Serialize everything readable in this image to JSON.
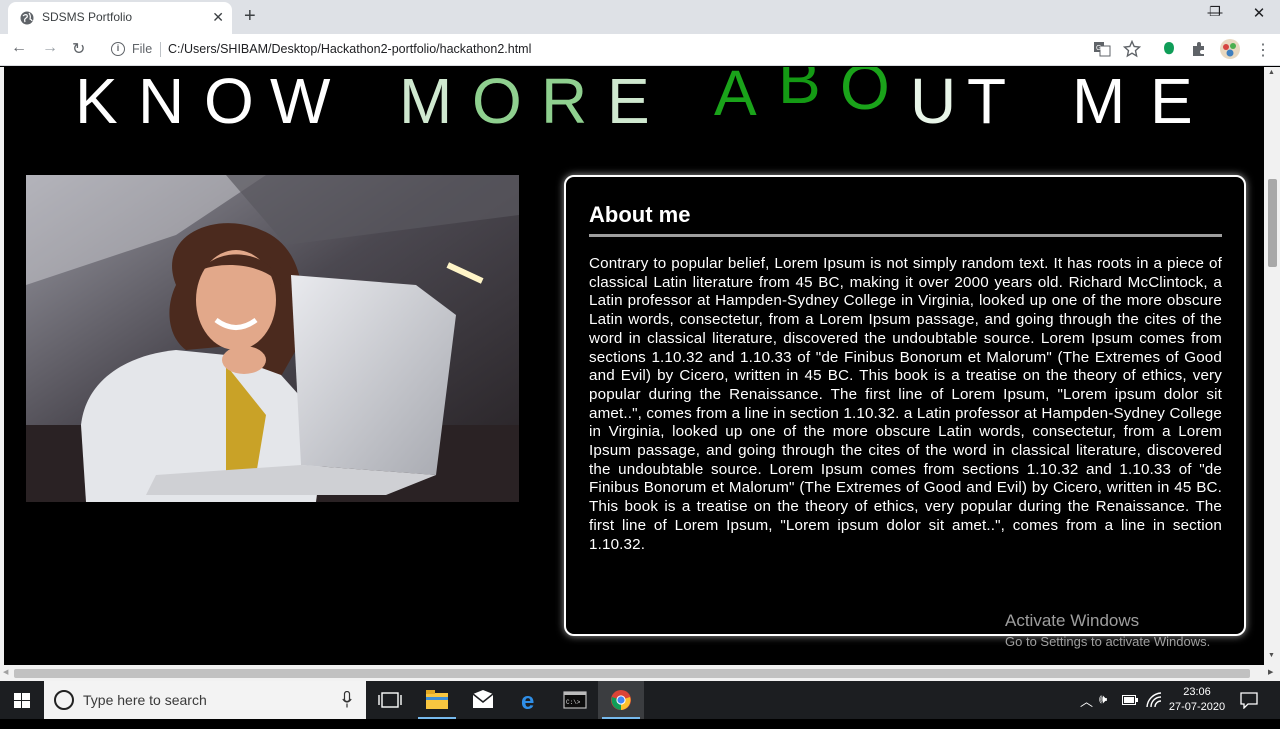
{
  "browser": {
    "tab_title": "SDSMS Portfolio",
    "tab_close": "✕",
    "new_tab": "+",
    "file_label": "File",
    "url": "C:/Users/SHIBAM/Desktop/Hackathon2-portfolio/hackathon2.html",
    "window_controls": [
      "—",
      "❐",
      "✕"
    ]
  },
  "page": {
    "heading_letters": [
      {
        "ch": "K",
        "color": "#ffffff"
      },
      {
        "ch": "N",
        "color": "#ffffff"
      },
      {
        "ch": "O",
        "color": "#ffffff"
      },
      {
        "ch": "W",
        "color": "#ffffff"
      },
      {
        "ch": "M",
        "color": "#cfe8cf"
      },
      {
        "ch": "O",
        "color": "#8fd08f"
      },
      {
        "ch": "R",
        "color": "#8fd08f"
      },
      {
        "ch": "E",
        "color": "#cfe8cf"
      },
      {
        "ch": "A",
        "color": "#1aa31a"
      },
      {
        "ch": "B",
        "color": "#149a14"
      },
      {
        "ch": "O",
        "color": "#1aa31a"
      },
      {
        "ch": "U",
        "color": "#e8f5e8"
      },
      {
        "ch": "T",
        "color": "#ffffff"
      },
      {
        "ch": "M",
        "color": "#ffffff"
      },
      {
        "ch": "E",
        "color": "#ffffff"
      }
    ],
    "about_title": "About me",
    "about_text": "Contrary to popular belief, Lorem Ipsum is not simply random text. It has roots in a piece of classical Latin literature from 45 BC, making it over 2000 years old. Richard McClintock, a Latin professor at Hampden-Sydney College in Virginia, looked up one of the more obscure Latin words, consectetur, from a Lorem Ipsum passage, and going through the cites of the word in classical literature, discovered the undoubtable source. Lorem Ipsum comes from sections 1.10.32 and 1.10.33 of \"de Finibus Bonorum et Malorum\" (The Extremes of Good and Evil) by Cicero, written in 45 BC. This book is a treatise on the theory of ethics, very popular during the Renaissance. The first line of Lorem Ipsum, \"Lorem ipsum dolor sit amet..\", comes from a line in section 1.10.32. a Latin professor at Hampden-Sydney College in Virginia, looked up one of the more obscure Latin words, consectetur, from a Lorem Ipsum passage, and going through the cites of the word in classical literature, discovered the undoubtable source. Lorem Ipsum comes from sections 1.10.32 and 1.10.33 of \"de Finibus Bonorum et Malorum\" (The Extremes of Good and Evil) by Cicero, written in 45 BC. This book is a treatise on the theory of ethics, very popular during the Renaissance. The first line of Lorem Ipsum, \"Lorem ipsum dolor sit amet..\", comes from a line in section 1.10.32."
  },
  "watermark": {
    "line1": "Activate Windows",
    "line2": "Go to Settings to activate Windows."
  },
  "taskbar": {
    "search_placeholder": "Type here to search",
    "time": "23:06",
    "date": "27-07-2020"
  }
}
